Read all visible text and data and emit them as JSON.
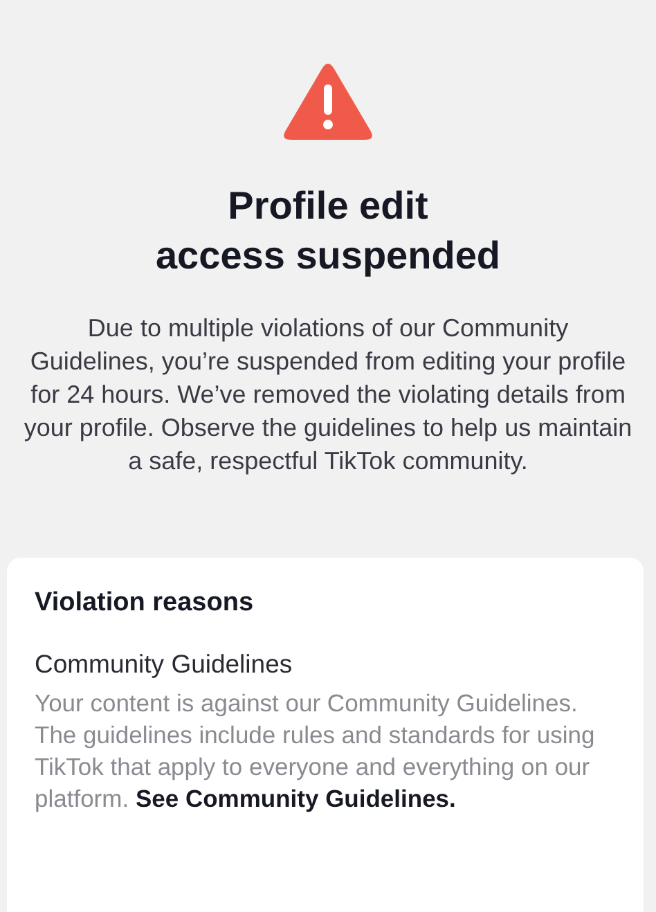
{
  "notice": {
    "title": "Profile edit\naccess suspended",
    "message": "Due to multiple violations of our Community Guidelines, you’re suspended from editing your profile for 24 hours. We’ve removed the violating details from your profile. Observe the guidelines to help us maintain a safe, respectful TikTok community."
  },
  "violation_card": {
    "heading": "Violation reasons",
    "reasons": [
      {
        "title": "Community Guidelines",
        "description": "Your content is against our Community Guidelines. The guidelines include rules and standards for using TikTok that apply to everyone and everything on our platform.",
        "link": "See Community Guidelines."
      }
    ]
  }
}
